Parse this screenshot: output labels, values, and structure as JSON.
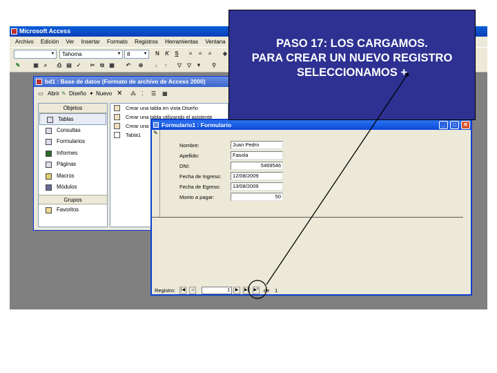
{
  "app": {
    "title": "Microsoft Access",
    "menu": [
      "Archivo",
      "Edición",
      "Ver",
      "Insertar",
      "Formato",
      "Registros",
      "Herramientas",
      "Ventana",
      "?"
    ],
    "font_name": "Tahoma",
    "font_size": "8",
    "bold_label": "N",
    "italic_label": "K",
    "underline_label": "S"
  },
  "db_window": {
    "title": "bd1 : Base de datos (Formato de archivo de Access 2000)",
    "toolbar": {
      "open": "Abrir",
      "design": "Diseño",
      "new": "Nuevo",
      "delete": "✕"
    },
    "objects_header": "Objetos",
    "objects": [
      "Tablas",
      "Consultas",
      "Formularios",
      "Informes",
      "Páginas",
      "Macros",
      "Módulos"
    ],
    "selected_object": "Tablas",
    "groups_header": "Grupos",
    "groups": [
      "Favoritos"
    ],
    "list_items": [
      "Crear una tabla en vista Diseño",
      "Crear una tabla utilizando el asistente",
      "Crear una tabla introduciendo datos",
      "Tabla1"
    ]
  },
  "form_window": {
    "title": "Formulario1 : Formulario",
    "record_selector": "✎",
    "fields": [
      {
        "label": "Nombre:",
        "value": "Juan Pedro",
        "numeric": false
      },
      {
        "label": "Apellido:",
        "value": "Fasola",
        "numeric": false
      },
      {
        "label": "DNI:",
        "value": "5469546",
        "numeric": true
      },
      {
        "label": "Fecha de Ingreso:",
        "value": "12/08/2009",
        "numeric": false
      },
      {
        "label": "Fecha de Egreso:",
        "value": "13/08/2009",
        "numeric": false
      },
      {
        "label": "Monto a pagar:",
        "value": "50",
        "numeric": true
      }
    ],
    "nav": {
      "label": "Registro:",
      "current": "1",
      "of_label": "de",
      "total": "1"
    }
  },
  "callout": {
    "lines": [
      "PASO 17: LOS CARGAMOS.",
      "PARA CREAR UN NUEVO REGISTRO",
      "SELECCIONAMOS +"
    ],
    "bg_color": "#2e3192"
  }
}
